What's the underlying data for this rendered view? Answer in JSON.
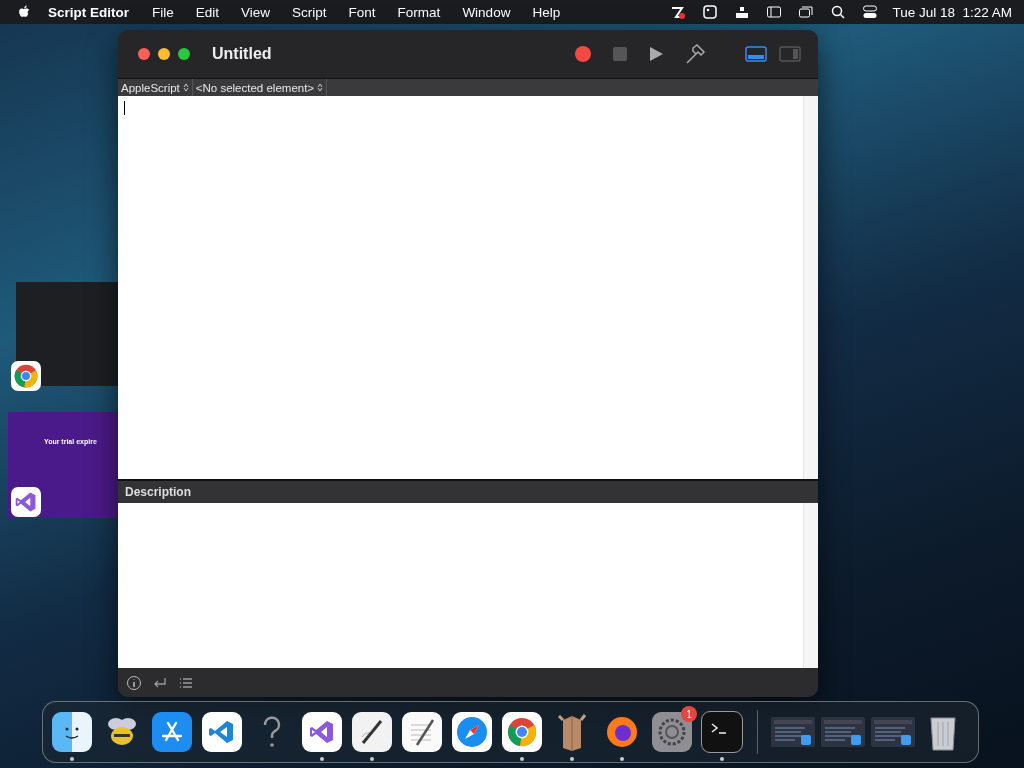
{
  "menu_bar": {
    "app_name": "Script Editor",
    "menus": [
      "File",
      "Edit",
      "View",
      "Script",
      "Font",
      "Format",
      "Window",
      "Help"
    ],
    "clock": "Tue Jul 18  1:22 AM"
  },
  "side_previews": [
    {
      "kind": "code"
    },
    {
      "kind": "trial",
      "caption": "Your trial expire"
    }
  ],
  "window": {
    "title": "Untitled",
    "view_buttons": [
      {
        "selected": true
      },
      {
        "selected": false
      }
    ],
    "language_popup": "AppleScript",
    "element_popup": "<No selected element>",
    "description_header": "Description"
  },
  "dock": [
    {
      "kind": "finder",
      "running": true
    },
    {
      "kind": "bee",
      "running": false
    },
    {
      "kind": "appstore",
      "running": false
    },
    {
      "kind": "vscode",
      "running": false
    },
    {
      "kind": "question",
      "running": false
    },
    {
      "kind": "visualstudio",
      "running": true
    },
    {
      "kind": "scripteditor",
      "running": true
    },
    {
      "kind": "textedit",
      "running": false
    },
    {
      "kind": "safari",
      "running": false
    },
    {
      "kind": "chrome",
      "running": true
    },
    {
      "kind": "package",
      "running": true
    },
    {
      "kind": "firefox",
      "running": true
    },
    {
      "kind": "settings",
      "running": false,
      "badge": "1"
    },
    {
      "kind": "terminal",
      "running": true
    },
    {
      "kind": "separator"
    },
    {
      "kind": "window",
      "running": false
    },
    {
      "kind": "window",
      "running": false
    },
    {
      "kind": "window",
      "running": false
    },
    {
      "kind": "trash",
      "running": false
    }
  ]
}
